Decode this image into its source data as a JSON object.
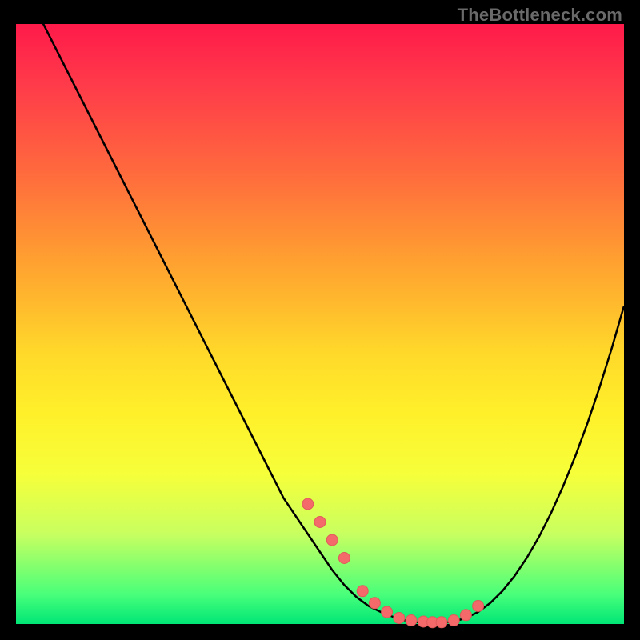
{
  "watermark": "TheBottleneck.com",
  "colors": {
    "curve": "#000000",
    "dot_fill": "#f46a6a",
    "dot_stroke": "#e05a5a",
    "gradient_top": "#ff1a4a",
    "gradient_bottom": "#00e676"
  },
  "chart_data": {
    "type": "line",
    "title": "",
    "xlabel": "",
    "ylabel": "",
    "xlim": [
      0,
      100
    ],
    "ylim": [
      0,
      100
    ],
    "x": [
      0,
      2,
      4,
      6,
      8,
      10,
      12,
      14,
      16,
      18,
      20,
      22,
      24,
      26,
      28,
      30,
      32,
      34,
      36,
      38,
      40,
      42,
      44,
      46,
      48,
      50,
      52,
      54,
      56,
      58,
      60,
      62,
      64,
      66,
      68,
      70,
      72,
      74,
      76,
      78,
      80,
      82,
      84,
      86,
      88,
      90,
      92,
      94,
      96,
      98,
      100
    ],
    "values": [
      108,
      105,
      101,
      97,
      93,
      89,
      85,
      81,
      77,
      73,
      69,
      65,
      61,
      57,
      53,
      49,
      45,
      41,
      37,
      33,
      29,
      25,
      21,
      18,
      15,
      12,
      9,
      6.5,
      4.5,
      3,
      2,
      1.2,
      0.6,
      0.3,
      0.2,
      0.2,
      0.4,
      1,
      2,
      3.5,
      5.5,
      8,
      11,
      14.5,
      18.5,
      23,
      28,
      33.5,
      39.5,
      46,
      53
    ],
    "series": [
      {
        "name": "dots",
        "x": [
          48,
          50,
          52,
          54,
          57,
          59,
          61,
          63,
          65,
          67,
          68.5,
          70,
          72,
          74,
          76
        ],
        "y": [
          20,
          17,
          14,
          11,
          5.5,
          3.5,
          2,
          1,
          0.6,
          0.4,
          0.3,
          0.3,
          0.6,
          1.5,
          3
        ]
      }
    ]
  }
}
